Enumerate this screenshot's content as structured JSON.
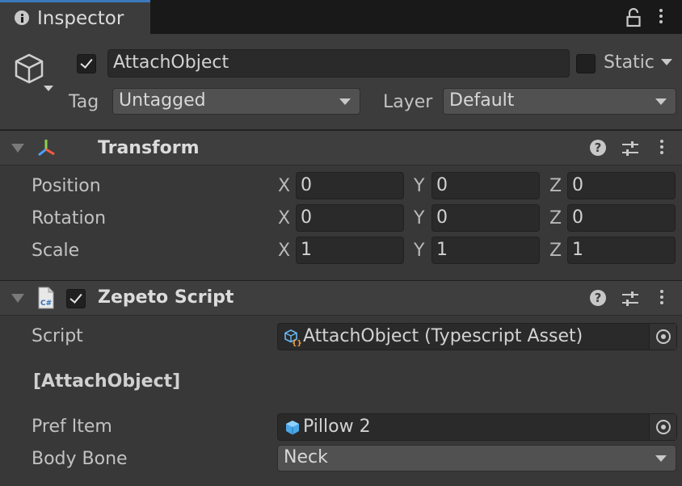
{
  "tab": {
    "label": "Inspector",
    "icon": "info-icon"
  },
  "window_controls": {
    "lock_icon": "lock-icon",
    "menu_icon": "kebab-menu-icon"
  },
  "object": {
    "active": true,
    "name": "AttachObject",
    "static_label": "Static",
    "static_checked": false,
    "tag_label": "Tag",
    "tag_value": "Untagged",
    "layer_label": "Layer",
    "layer_value": "Default"
  },
  "transform": {
    "title": "Transform",
    "rows": [
      {
        "label": "Position",
        "x": "0",
        "y": "0",
        "z": "0"
      },
      {
        "label": "Rotation",
        "x": "0",
        "y": "0",
        "z": "0"
      },
      {
        "label": "Scale",
        "x": "1",
        "y": "1",
        "z": "1"
      }
    ],
    "axis_labels": {
      "x": "X",
      "y": "Y",
      "z": "Z"
    }
  },
  "zepeto_script": {
    "title": "Zepeto Script",
    "enabled": true,
    "script_label": "Script",
    "script_value": "AttachObject (Typescript Asset)",
    "section_header": "[AttachObject]",
    "pref_item_label": "Pref Item",
    "pref_item_value": "Pillow 2",
    "body_bone_label": "Body Bone",
    "body_bone_value": "Neck"
  },
  "colors": {
    "accent": "#3a79bb",
    "panel": "#383838",
    "header": "#3c3c3c",
    "field": "#2a2a2a",
    "dropdown": "#515151"
  }
}
